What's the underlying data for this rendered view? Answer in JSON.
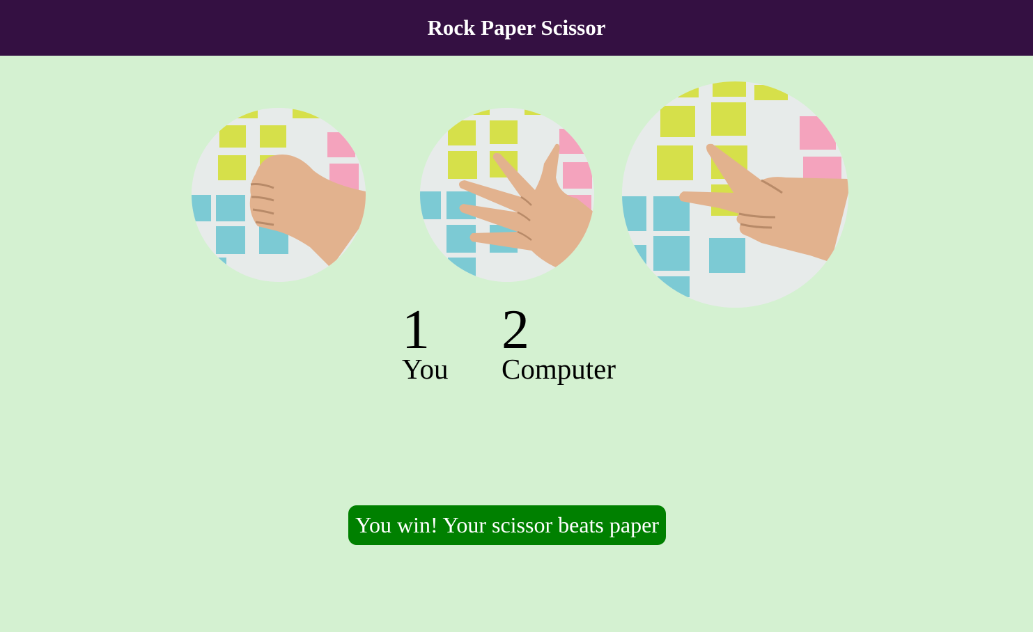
{
  "app": {
    "title": "Rock Paper Scissor"
  },
  "choices": [
    {
      "name": "rock",
      "icon": "rock-fist-icon"
    },
    {
      "name": "paper",
      "icon": "paper-open-hand-icon"
    },
    {
      "name": "scissor",
      "icon": "scissor-v-hand-icon"
    }
  ],
  "scores": {
    "user": {
      "value": "1",
      "label": "You"
    },
    "computer": {
      "value": "2",
      "label": "Computer"
    }
  },
  "message": {
    "text": "You win! Your scissor beats paper",
    "color": "#008000"
  },
  "colors": {
    "header": "#341042",
    "background": "#d4f1d1",
    "note_yellow": "#d6e04a",
    "note_pink": "#f4a3bd",
    "note_cyan": "#7ccad4",
    "skin": "#e2b28e"
  }
}
